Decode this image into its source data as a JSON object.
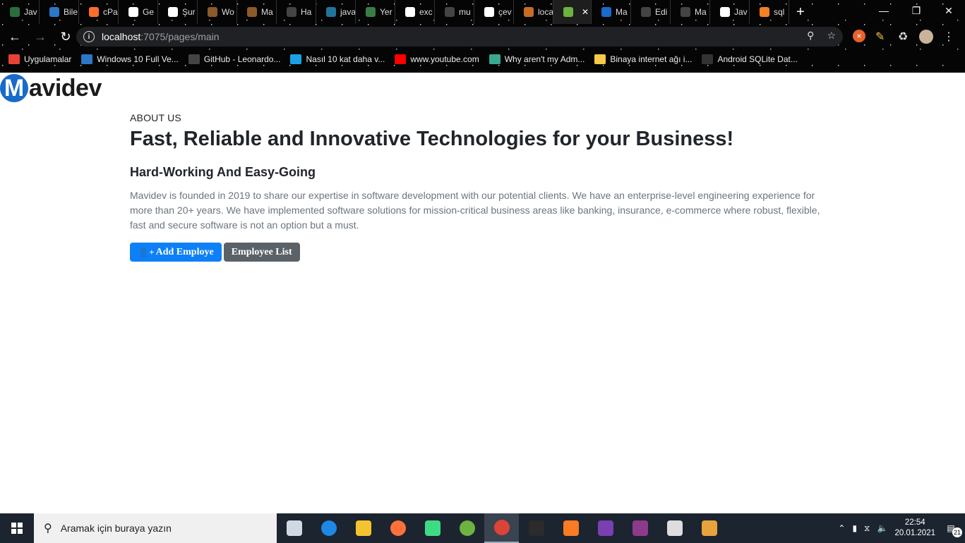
{
  "browser": {
    "tabs": [
      {
        "label": "Jav",
        "color": "#2a6e3f"
      },
      {
        "label": "Bile",
        "color": "#2b78c6"
      },
      {
        "label": "cPa",
        "color": "#ff6c2c"
      },
      {
        "label": "Ge",
        "color": "#ffffff"
      },
      {
        "label": "Şur",
        "color": "#ffffff"
      },
      {
        "label": "Wo",
        "color": "#8b5a2b"
      },
      {
        "label": "Ma",
        "color": "#8b5a2b"
      },
      {
        "label": "Ha",
        "color": "#444444"
      },
      {
        "label": "java",
        "color": "#21759b"
      },
      {
        "label": "Yer",
        "color": "#3a7d44"
      },
      {
        "label": "exc",
        "color": "#ffffff"
      },
      {
        "label": "mu",
        "color": "#444444"
      },
      {
        "label": "çev",
        "color": "#ffffff"
      },
      {
        "label": "loca",
        "color": "#c76b29"
      },
      {
        "label": "",
        "color": "#6db33f"
      },
      {
        "label": "Ma",
        "color": "#1a6ac9"
      },
      {
        "label": "Edi",
        "color": "#444444"
      },
      {
        "label": "Ma",
        "color": "#444444"
      },
      {
        "label": "Jav",
        "color": "#ffffff"
      },
      {
        "label": "sql",
        "color": "#f48024"
      }
    ],
    "url_host": "localhost",
    "url_path": ":7075/pages/main",
    "bookmarks": [
      {
        "label": "Uygulamalar",
        "color": "#e94235"
      },
      {
        "label": "Windows 10 Full Ve...",
        "color": "#2b78c6"
      },
      {
        "label": "GitHub - Leonardo...",
        "color": "#444444"
      },
      {
        "label": "Nasıl 10 kat daha v...",
        "color": "#1ba1e2"
      },
      {
        "label": "www.youtube.com",
        "color": "#ff0000"
      },
      {
        "label": "Why aren't my Adm...",
        "color": "#3aa88f"
      },
      {
        "label": "Binaya internet ağı i...",
        "color": "#f7c948"
      },
      {
        "label": "Android SQLite Dat...",
        "color": "#333333"
      }
    ]
  },
  "site": {
    "logo_letter": "M",
    "logo_text": "avidev",
    "eyebrow": "ABOUT US",
    "headline": "Fast, Reliable and Innovative Technologies for your Business!",
    "subhead": "Hard-Working And Easy-Going",
    "paragraph": "Mavidev is founded in 2019 to share our expertise in software development with our potential clients. We have an enterprise-level engineering experience for more than 20+ years. We have implemented software solutions for mission-critical business areas like banking, insurance, e-commerce where robust, flexible, fast and secure software is not an option but a must.",
    "add_button": "Add Employe",
    "list_button": "Employee List",
    "accent": "#0d80f8",
    "secondary": "#5a6268"
  },
  "taskbar": {
    "search_placeholder": "Aramak için buraya yazın",
    "time": "22:54",
    "date": "20.01.2021",
    "notification_count": "21",
    "apps": [
      {
        "name": "task-view-icon",
        "color": "#cfd8e3"
      },
      {
        "name": "edge-icon",
        "color": "#1e88e5"
      },
      {
        "name": "file-explorer-icon",
        "color": "#f4c430"
      },
      {
        "name": "firefox-icon",
        "color": "#ff7139"
      },
      {
        "name": "android-studio-icon",
        "color": "#3ddc84"
      },
      {
        "name": "spring-icon",
        "color": "#6db33f"
      },
      {
        "name": "chrome-icon",
        "color": "#db4437"
      },
      {
        "name": "terminal-icon",
        "color": "#2b2b2b"
      },
      {
        "name": "xampp-icon",
        "color": "#fb7a24"
      },
      {
        "name": "game-icon",
        "color": "#7a3fb0"
      },
      {
        "name": "winrar-icon",
        "color": "#8e3a8c"
      },
      {
        "name": "git-icon",
        "color": "#dddddd"
      },
      {
        "name": "paint-icon",
        "color": "#e8a33d"
      }
    ]
  }
}
